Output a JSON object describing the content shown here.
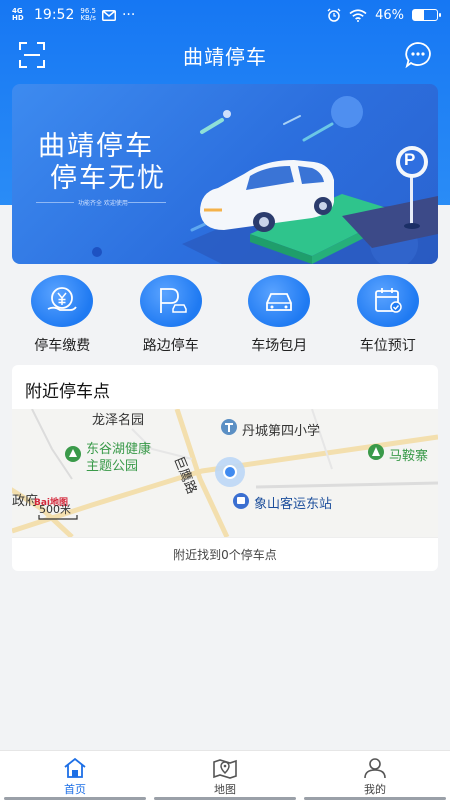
{
  "status": {
    "network": "4G HD",
    "time": "19:52",
    "speed_value": "96.5",
    "speed_unit": "KB/s",
    "battery": "46%",
    "battery_level": 0.46
  },
  "header": {
    "title": "曲靖停车"
  },
  "banner": {
    "line1": "曲靖停车",
    "line2": "停车无忧",
    "subtitle": "功能齐全 欢迎使用",
    "sign_letter": "P"
  },
  "services": [
    {
      "label": "停车缴费",
      "icon": "yuan-hand-icon"
    },
    {
      "label": "路边停车",
      "icon": "roadside-parking-icon"
    },
    {
      "label": "车场包月",
      "icon": "car-icon"
    },
    {
      "label": "车位预订",
      "icon": "calendar-check-icon"
    }
  ],
  "nearby": {
    "title": "附近停车点",
    "footer": "附近找到0个停车点",
    "map_labels": {
      "longze": "龙泽名园",
      "dongu_line1": "东谷湖健康",
      "dongu_line2": "主题公园",
      "school": "丹城第四小学",
      "road": "巨鹰路",
      "maanzhai": "马鞍寨",
      "station": "象山客运东站",
      "gov": "政府",
      "scale": "500米",
      "logo": "Bai地图"
    }
  },
  "tabs": [
    {
      "label": "首页",
      "icon": "home-icon",
      "active": true
    },
    {
      "label": "地图",
      "icon": "map-icon",
      "active": false
    },
    {
      "label": "我的",
      "icon": "user-icon",
      "active": false
    }
  ],
  "colors": {
    "primary": "#1677f3",
    "active_tab": "#1d6fe6",
    "green": "#3a9a4a"
  }
}
